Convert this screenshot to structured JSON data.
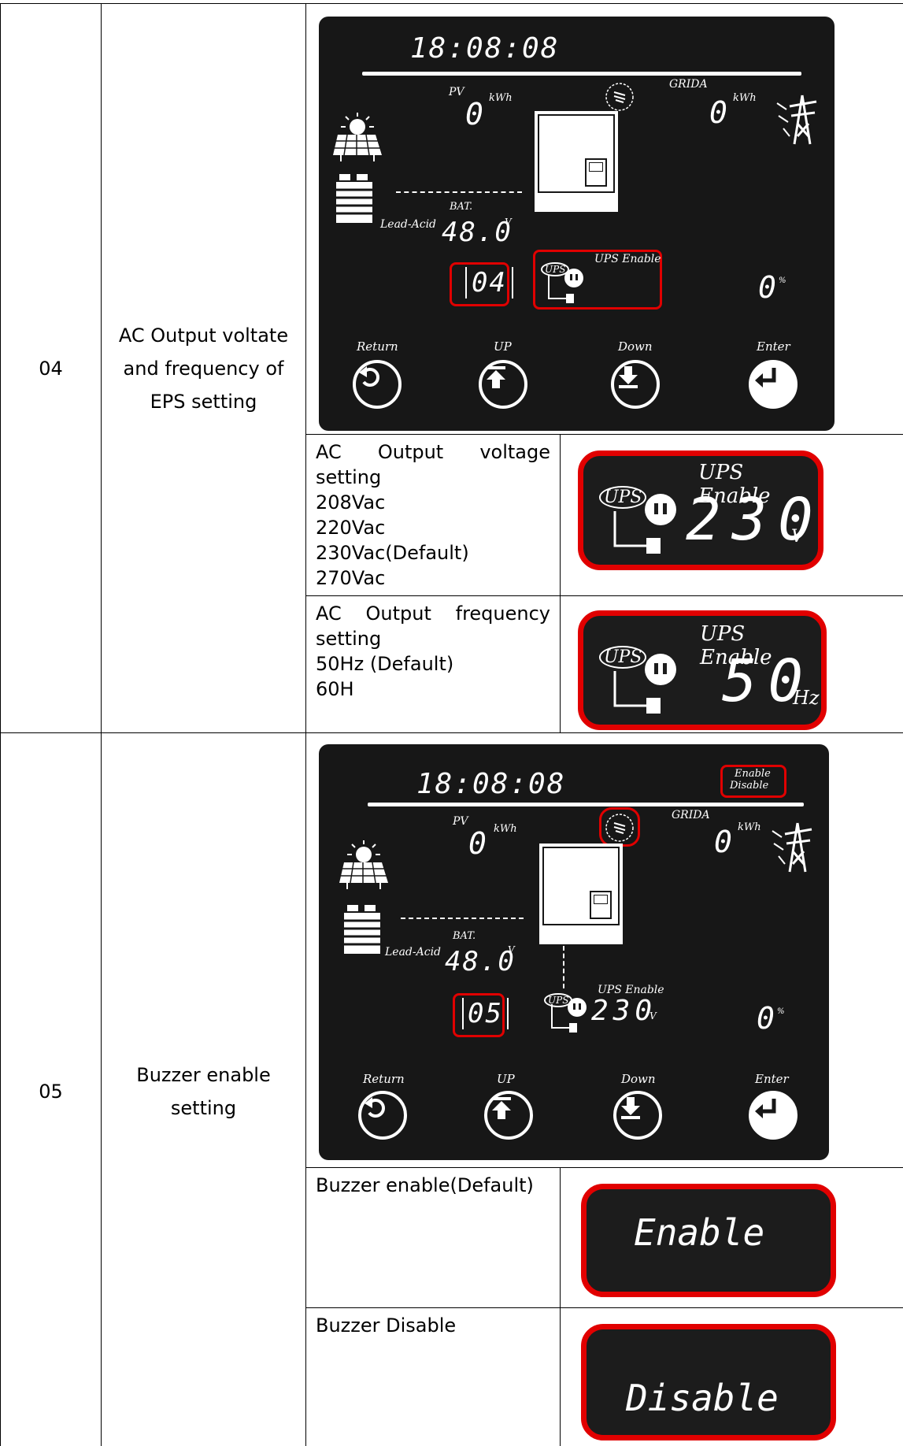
{
  "rows": [
    {
      "no": "04",
      "item": "AC Output voltate and frequency of EPS setting",
      "screen": {
        "time": "18:08:08",
        "pv_label": "PV",
        "pv_value": "0",
        "pv_unit": "kWh",
        "grid_label": "GRIDA",
        "grid_value": "0",
        "grid_unit": "kWh",
        "bat_label": "BAT.",
        "bat_type": "Lead-Acid",
        "bat_value": "48.0",
        "bat_unit": "V",
        "menu_code": "04",
        "ups_label": "UPS Enable",
        "ups_badge": "UPS",
        "percent_value": "0",
        "percent_unit": "%",
        "buttons": [
          "Return",
          "UP",
          "Down",
          "Enter"
        ]
      },
      "sub": [
        {
          "title": "AC Output voltage setting",
          "options": [
            "208Vac",
            "220Vac",
            "230Vac(Default)",
            "270Vac"
          ],
          "panel": {
            "label": "UPS Enable",
            "badge": "UPS",
            "value": "230",
            "unit": "V"
          }
        },
        {
          "title": "AC Output frequency setting",
          "options": [
            "50Hz (Default)",
            "60H"
          ],
          "panel": {
            "label": "UPS Enable",
            "badge": "UPS",
            "value": "50",
            "unit": "Hz"
          }
        }
      ]
    },
    {
      "no": "05",
      "item": "Buzzer enable setting",
      "screen": {
        "time": "18:08:08",
        "enable_text": "Enable",
        "disable_text": "Disable",
        "pv_label": "PV",
        "pv_value": "0",
        "pv_unit": "kWh",
        "grid_label": "GRIDA",
        "grid_value": "0",
        "grid_unit": "kWh",
        "bat_label": "BAT.",
        "bat_type": "Lead-Acid",
        "bat_value": "48.0",
        "bat_unit": "V",
        "menu_code": "05",
        "ups_label": "UPS Enable",
        "ups_badge": "UPS",
        "ups_value": "230",
        "ups_unit": "V",
        "percent_value": "0",
        "percent_unit": "%",
        "buttons": [
          "Return",
          "UP",
          "Down",
          "Enter"
        ]
      },
      "sub": [
        {
          "title": "Buzzer enable(Default)",
          "panel": "Enable"
        },
        {
          "title": "Buzzer Disable",
          "panel": "Disable"
        }
      ]
    }
  ],
  "colors": {
    "lcd_bg": "#171717",
    "highlight": "#e10000",
    "segment": "#ffffff"
  }
}
